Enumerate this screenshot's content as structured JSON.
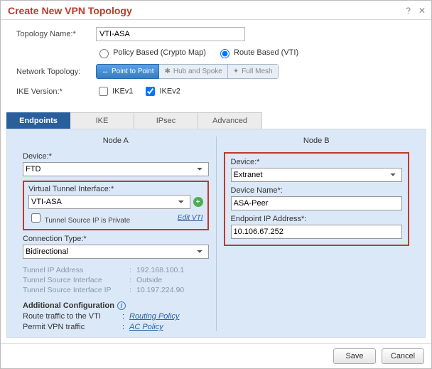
{
  "dialog": {
    "title": "Create New VPN Topology"
  },
  "form": {
    "topologyName": {
      "label": "Topology Name:*",
      "value": "VTI-ASA"
    },
    "policyRadios": {
      "policy": "Policy Based (Crypto Map)",
      "route": "Route Based (VTI)",
      "selected": "route"
    },
    "networkTopology": {
      "label": "Network Topology:",
      "options": {
        "p2p": "Point to Point",
        "hub": "Hub and Spoke",
        "full": "Full Mesh"
      }
    },
    "ike": {
      "label": "IKE Version:*",
      "v1": "IKEv1",
      "v2": "IKEv2"
    }
  },
  "tabs": {
    "endpoints": "Endpoints",
    "ike": "IKE",
    "ipsec": "IPsec",
    "advanced": "Advanced"
  },
  "nodeA": {
    "title": "Node A",
    "deviceLabel": "Device:*",
    "deviceValue": "FTD",
    "vtiLabel": "Virtual Tunnel Interface:*",
    "vtiValue": "VTI-ASA",
    "privateLabel": "Tunnel Source IP is Private",
    "editVti": "Edit VTI",
    "connLabel": "Connection Type:*",
    "connValue": "Bidirectional",
    "kv": {
      "ipLabel": "Tunnel IP Address",
      "ipVal": "192.168.100.1",
      "srcIfLabel": "Tunnel Source Interface",
      "srcIfVal": "Outside",
      "srcIpLabel": "Tunnel Source Interface IP",
      "srcIpVal": "10.197.224.90"
    },
    "addl": {
      "header": "Additional Configuration",
      "routeLabel": "Route traffic to the VTI",
      "routeLink": "Routing Policy",
      "permitLabel": "Permit VPN traffic",
      "permitLink": "AC Policy"
    }
  },
  "nodeB": {
    "title": "Node B",
    "deviceLabel": "Device:*",
    "deviceValue": "Extranet",
    "devNameLabel": "Device Name*:",
    "devNameValue": "ASA-Peer",
    "endpointLabel": "Endpoint IP Address*:",
    "endpointValue": "10.106.67.252"
  },
  "footer": {
    "save": "Save",
    "cancel": "Cancel"
  }
}
